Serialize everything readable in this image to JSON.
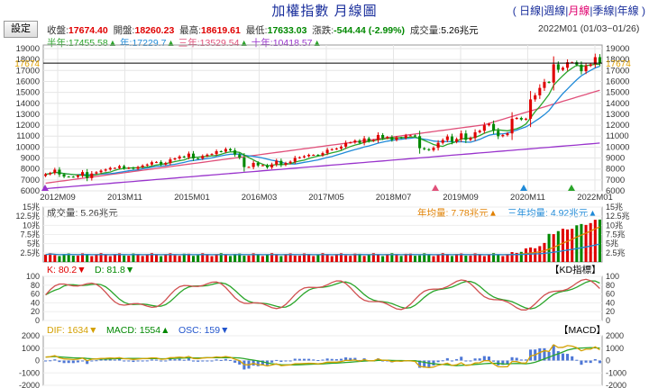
{
  "title": "加權指數   月線圖",
  "periods": [
    {
      "label": "日線",
      "active": false
    },
    {
      "label": "週線",
      "active": false
    },
    {
      "label": "月線",
      "active": true
    },
    {
      "label": "季線",
      "active": false
    },
    {
      "label": "年線",
      "active": false
    }
  ],
  "settings_label": "設定",
  "quote": {
    "close_label": "收盤:",
    "close": "17674.40",
    "open_label": "開盤:",
    "open": "18260.23",
    "high_label": "最高:",
    "high": "18619.61",
    "low_label": "最低:",
    "low": "17633.03",
    "change_label": "漲跌:",
    "change": "-544.44 (-2.99%)",
    "volume_label": "成交量:",
    "volume": "5.26兆元",
    "period": "2022M01 (01/03~01/26)"
  },
  "ma": [
    {
      "label": "半年:17455.58",
      "color": "#2aa52a"
    },
    {
      "label": "年:17229.7",
      "color": "#1f8ad8"
    },
    {
      "label": "三年:13529.54",
      "color": "#e0507a"
    },
    {
      "label": "十年:10418.57",
      "color": "#9933cc"
    }
  ],
  "price_tag": "17674",
  "price_axis": [
    "19000",
    "18000",
    "17000",
    "16000",
    "15000",
    "14000",
    "13000",
    "12000",
    "11000",
    "10000",
    "9000",
    "8000",
    "7000",
    "6000"
  ],
  "x_labels": [
    "2012M09",
    "2013M11",
    "2015M01",
    "2016M03",
    "2017M05",
    "2018M07",
    "2019M09",
    "2020M11",
    "2022M01"
  ],
  "volume_panel": {
    "label": "成交量:",
    "value": "5.26兆元",
    "year_avg": "年均量: 7.78兆元",
    "three_year_avg": "三年均量: 4.92兆元",
    "axis": [
      "15兆",
      "12.5兆",
      "10兆",
      "7.5兆",
      "5兆",
      "2.5兆"
    ]
  },
  "kd_panel": {
    "k_label": "K: 80.2",
    "d_label": "D: 81.8",
    "name": "【KD指標】",
    "axis": [
      "100",
      "80",
      "60",
      "40",
      "20",
      "0"
    ]
  },
  "macd_panel": {
    "dif_label": "DIF: 1634",
    "macd_label": "MACD: 1554",
    "osc_label": "OSC: 159",
    "name": "【MACD】",
    "axis": [
      "2000",
      "1000",
      "0",
      "-1000",
      "-2000"
    ]
  },
  "colors": {
    "up": "#e00000",
    "down": "#008800",
    "ma_half": "#2aa52a",
    "ma_year": "#1f8ad8",
    "ma_3y": "#e0507a",
    "ma_10y": "#9933cc",
    "k_line": "#d05050",
    "d_line": "#2aa52a",
    "dif": "#d4a000",
    "macd": "#2aa52a",
    "osc": "#2255cc"
  },
  "chart_data": {
    "type": "candlestick",
    "x_range": [
      "2012M01",
      "2022M01"
    ],
    "price_range": [
      6000,
      19000
    ],
    "closes": [
      7517,
      7634,
      7933,
      7501,
      7302,
      7296,
      7270,
      7398,
      7715,
      7166,
      7581,
      7700,
      7850,
      7950,
      8093,
      8093,
      8254,
      8062,
      8107,
      8022,
      8174,
      8312,
      8406,
      8612,
      8643,
      8406,
      8541,
      8872,
      8962,
      9137,
      9076,
      9403,
      8968,
      8966,
      9187,
      9307,
      9361,
      9622,
      9586,
      9820,
      9701,
      9323,
      9044,
      8174,
      8181,
      8554,
      8320,
      8338,
      8145,
      8411,
      8744,
      8377,
      8535,
      8666,
      9008,
      9068,
      9166,
      9290,
      9290,
      9253,
      9447,
      9750,
      9811,
      9872,
      10040,
      10395,
      10427,
      10586,
      10383,
      10793,
      10560,
      10643,
      11103,
      10815,
      10919,
      10657,
      10875,
      10837,
      11057,
      11063,
      10997,
      9898,
      9808,
      9727,
      9932,
      10389,
      10641,
      10967,
      10498,
      10731,
      11247,
      10661,
      10829,
      11358,
      11489,
      11997,
      12118,
      11495,
      10992,
      11094,
      11247,
      12591,
      12664,
      12516,
      12591,
      14358,
      14732,
      15410,
      15953,
      15900,
      17567,
      17068,
      17247,
      17755,
      17755,
      17527,
      16934,
      17427,
      17566,
      18219,
      17674
    ]
  }
}
